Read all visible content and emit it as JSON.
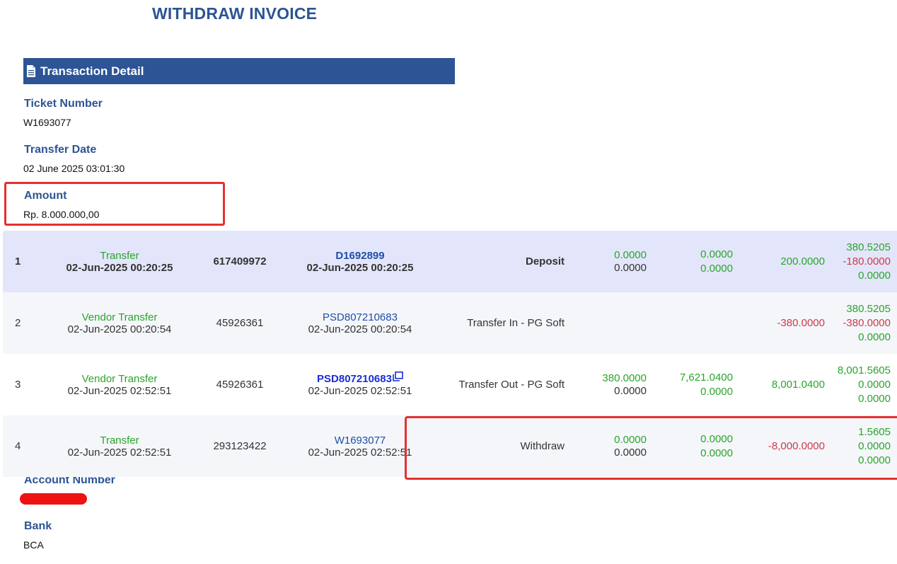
{
  "page": {
    "title": "WITHDRAW INVOICE",
    "section_title": "Transaction Detail",
    "section_icon": "document-icon"
  },
  "fields": {
    "ticket_number": {
      "label": "Ticket Number",
      "value": "W1693077"
    },
    "transfer_date": {
      "label": "Transfer Date",
      "value": "02 June 2025 03:01:30"
    },
    "amount": {
      "label": "Amount",
      "value": "Rp. 8.000.000,00"
    },
    "account_number": {
      "label": "Account Number",
      "value_redacted": true
    },
    "bank": {
      "label": "Bank",
      "value": "BCA"
    }
  },
  "transactions": [
    {
      "no": "1",
      "type": "Transfer",
      "datetime": "02-Jun-2025 00:20:25",
      "id": "617409972",
      "ref": "D1692899",
      "ref_datetime": "02-Jun-2025 00:20:25",
      "description": "Deposit",
      "col_a": [
        "0.0000",
        "0.0000"
      ],
      "col_b": [
        "0.0000",
        "0.0000"
      ],
      "col_c": "200.0000",
      "col_d": [
        "380.5205",
        "-180.0000",
        "0.0000"
      ]
    },
    {
      "no": "2",
      "type": "Vendor Transfer",
      "datetime": "02-Jun-2025 00:20:54",
      "id": "45926361",
      "ref": "PSD807210683",
      "ref_datetime": "02-Jun-2025 00:20:54",
      "description": "Transfer In - PG Soft",
      "col_a": [
        "",
        ""
      ],
      "col_b": [
        "",
        ""
      ],
      "col_c": "-380.0000",
      "col_d": [
        "380.5205",
        "-380.0000",
        "0.0000"
      ]
    },
    {
      "no": "3",
      "type": "Vendor Transfer",
      "datetime": "02-Jun-2025 02:52:51",
      "id": "45926361",
      "ref": "PSD807210683",
      "ref_datetime": "02-Jun-2025 02:52:51",
      "description": "Transfer Out - PG Soft",
      "col_a": [
        "380.0000",
        "0.0000"
      ],
      "col_b": [
        "7,621.0400",
        "0.0000"
      ],
      "col_c": "8,001.0400",
      "col_d": [
        "8,001.5605",
        "0.0000",
        "0.0000"
      ]
    },
    {
      "no": "4",
      "type": "Transfer",
      "datetime": "02-Jun-2025 02:52:51",
      "id": "293123422",
      "ref": "W1693077",
      "ref_datetime": "02-Jun-2025 02:52:51",
      "description": "Withdraw",
      "col_a": [
        "0.0000",
        "0.0000"
      ],
      "col_b": [
        "0.0000",
        "0.0000"
      ],
      "col_c": "-8,000.0000",
      "col_d": [
        "1.5605",
        "0.0000",
        "0.0000"
      ]
    }
  ],
  "colors": {
    "brand_blue": "#2d5494",
    "positive": "#2aa52a",
    "negative": "#cc3b4a",
    "highlight_border": "#e53030",
    "row_highlight": "#e3e6fb"
  }
}
